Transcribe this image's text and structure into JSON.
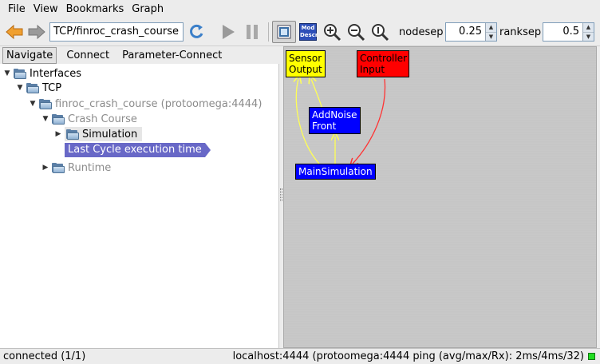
{
  "menu": {
    "file": "File",
    "view": "View",
    "bookmarks": "Bookmarks",
    "graph": "Graph"
  },
  "toolbar": {
    "address": "TCP/finroc_crash_course",
    "moddescr_line1": "Mod",
    "moddescr_line2": "Descr",
    "nodesep_label": "nodesep",
    "nodesep_value": "0.25",
    "ranksep_label": "ranksep",
    "ranksep_value": "0.5"
  },
  "tabs": [
    "Navigate",
    "Connect",
    "Parameter-Connect"
  ],
  "tree": {
    "interfaces": "Interfaces",
    "tcp": "TCP",
    "finroc": "finroc_crash_course (protoomega:4444)",
    "crash_course": "Crash Course",
    "simulation": "Simulation",
    "last_cycle": "Last Cycle execution time",
    "runtime": "Runtime"
  },
  "graph": {
    "sensor_output_l1": "Sensor",
    "sensor_output_l2": "Output",
    "controller_input_l1": "Controller",
    "controller_input_l2": "Input",
    "addnoise_l1": "AddNoise",
    "addnoise_l2": "Front",
    "main_simulation": "MainSimulation",
    "colors": {
      "interface_yellow": "#ffff00",
      "interface_red": "#ff0000",
      "module_blue": "#0000ff",
      "edge_yellow": "#ffff55",
      "edge_red": "#ff3333"
    }
  },
  "status": {
    "connection": "connected (1/1)",
    "server": "localhost:4444 (protoomega:4444 ping (avg/max/Rx): 2ms/4ms/32)"
  },
  "icons": {
    "back": "back-arrow-icon",
    "forward": "forward-arrow-icon",
    "refresh": "refresh-icon",
    "play": "play-icon",
    "pause": "pause-icon",
    "graph_view": "graph-view-icon",
    "zoom_in": "zoom-in-icon",
    "zoom_out": "zoom-out-icon",
    "zoom_reset": "zoom-reset-icon"
  }
}
